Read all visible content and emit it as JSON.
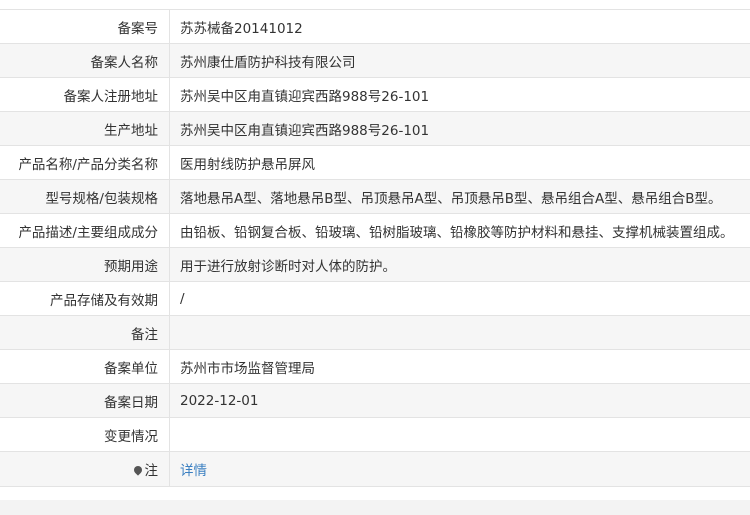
{
  "record": {
    "rows": [
      {
        "label": "备案号",
        "value": "苏苏械备20141012"
      },
      {
        "label": "备案人名称",
        "value": "苏州康仕盾防护科技有限公司"
      },
      {
        "label": "备案人注册地址",
        "value": "苏州吴中区甪直镇迎宾西路988号26-101"
      },
      {
        "label": "生产地址",
        "value": "苏州吴中区甪直镇迎宾西路988号26-101"
      },
      {
        "label": "产品名称/产品分类名称",
        "value": "医用射线防护悬吊屏风"
      },
      {
        "label": "型号规格/包装规格",
        "value": "落地悬吊A型、落地悬吊B型、吊顶悬吊A型、吊顶悬吊B型、悬吊组合A型、悬吊组合B型。"
      },
      {
        "label": "产品描述/主要组成成分",
        "value": "由铅板、铅钢复合板、铅玻璃、铅树脂玻璃、铅橡胶等防护材料和悬挂、支撑机械装置组成。"
      },
      {
        "label": "预期用途",
        "value": "用于进行放射诊断时对人体的防护。"
      },
      {
        "label": "产品存储及有效期",
        "value": "/"
      },
      {
        "label": "备注",
        "value": ""
      },
      {
        "label": "备案单位",
        "value": "苏州市市场监督管理局"
      },
      {
        "label": "备案日期",
        "value": "2022-12-01"
      },
      {
        "label": "变更情况",
        "value": ""
      }
    ],
    "note": {
      "label": "注",
      "icon": "pin-icon",
      "link_text": "详情",
      "link_color": "#3a7fc1"
    }
  }
}
